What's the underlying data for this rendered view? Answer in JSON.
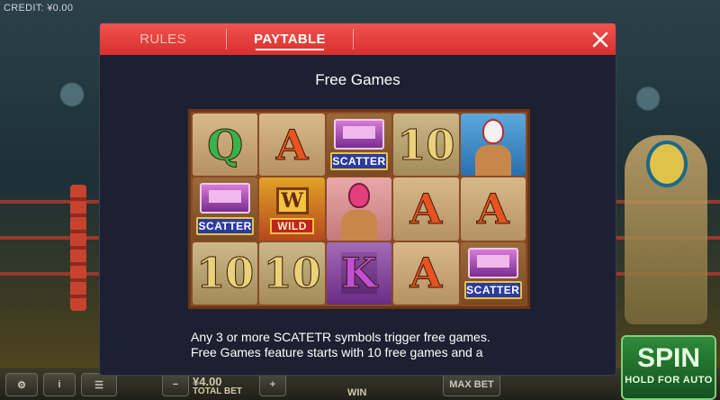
{
  "background": {
    "credit_text": "CREDIT: ¥0.00",
    "total_bet_amount": "¥4.00",
    "total_bet_label": "TOTAL BET",
    "plus_label": "+",
    "win_label": "WIN",
    "max_bet_label": "MAX BET",
    "spin_label": "SPIN",
    "spin_sub_label": "HOLD FOR AUTO"
  },
  "modal": {
    "tabs": [
      {
        "label": "RULES",
        "active": false
      },
      {
        "label": "PAYTABLE",
        "active": true
      }
    ],
    "close_icon": "close-icon",
    "title": "Free Games",
    "reels": [
      [
        {
          "type": "letter",
          "value": "Q",
          "style": "q"
        },
        {
          "type": "letter",
          "value": "A",
          "style": "a"
        },
        {
          "type": "scatter",
          "value": "SCATTER"
        },
        {
          "type": "letter",
          "value": "10",
          "style": "10"
        },
        {
          "type": "luchador",
          "value": "luchador-blue"
        }
      ],
      [
        {
          "type": "scatter",
          "value": "SCATTER"
        },
        {
          "type": "wild",
          "value": "WILD",
          "w": "W"
        },
        {
          "type": "luchador",
          "value": "luchador-pink"
        },
        {
          "type": "letter",
          "value": "A",
          "style": "a"
        },
        {
          "type": "letter",
          "value": "A",
          "style": "a"
        }
      ],
      [
        {
          "type": "letter",
          "value": "10",
          "style": "10"
        },
        {
          "type": "letter",
          "value": "10",
          "style": "10"
        },
        {
          "type": "letter",
          "value": "K",
          "style": "k"
        },
        {
          "type": "letter",
          "value": "A",
          "style": "a"
        },
        {
          "type": "scatter",
          "value": "SCATTER"
        }
      ]
    ],
    "description_line1": "Any 3 or more SCATETR symbols trigger free games.",
    "description_line2": "Free Games feature starts with 10 free games and a"
  },
  "colors": {
    "header_red": "#e8403c",
    "modal_bg": "#1c2031",
    "spin_green": "#2e8a3a"
  }
}
